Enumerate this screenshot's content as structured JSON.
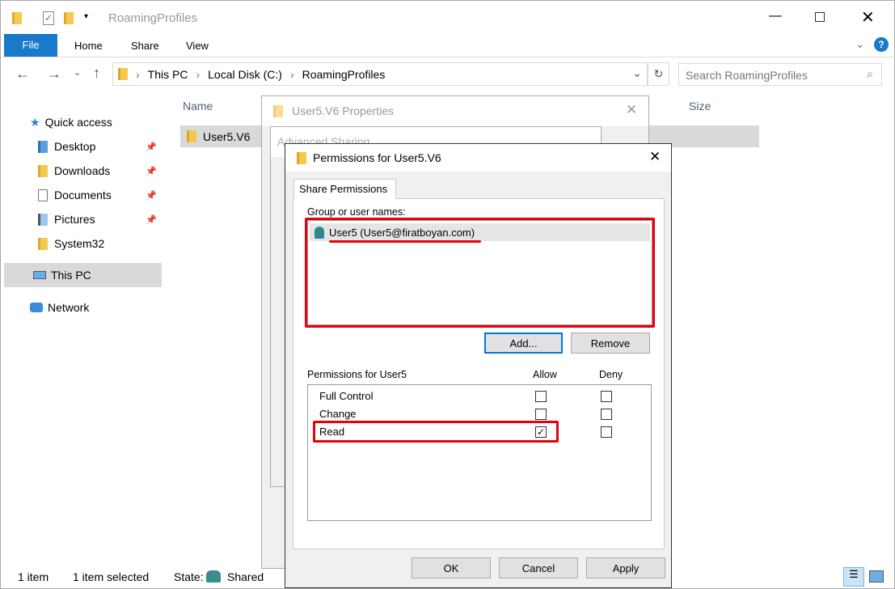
{
  "window": {
    "title": "RoamingProfiles"
  },
  "ribbon": {
    "tabs": [
      "File",
      "Home",
      "Share",
      "View"
    ]
  },
  "address": {
    "crumbs": [
      "This PC",
      "Local Disk (C:)",
      "RoamingProfiles"
    ],
    "search_placeholder": "Search RoamingProfiles"
  },
  "nav": {
    "quick_access": "Quick access",
    "items": [
      {
        "label": "Desktop",
        "pinned": true
      },
      {
        "label": "Downloads",
        "pinned": true
      },
      {
        "label": "Documents",
        "pinned": true
      },
      {
        "label": "Pictures",
        "pinned": true
      },
      {
        "label": "System32",
        "pinned": false
      }
    ],
    "this_pc": "This PC",
    "network": "Network"
  },
  "files": {
    "columns": [
      "Name",
      "Size"
    ],
    "rows": [
      {
        "name": "User5.V6"
      }
    ]
  },
  "properties_dialog": {
    "title": "User5.V6 Properties"
  },
  "advanced_dialog": {
    "title": "Advanced Sharing"
  },
  "perm_dialog": {
    "title": "Permissions for User5.V6",
    "tab": "Share Permissions",
    "group_label": "Group or user names:",
    "users": [
      "User5 (User5@firatboyan.com)"
    ],
    "add": "Add...",
    "remove": "Remove",
    "perm_label": "Permissions for User5",
    "allow": "Allow",
    "deny": "Deny",
    "permissions": [
      {
        "name": "Full Control",
        "allow": false,
        "deny": false
      },
      {
        "name": "Change",
        "allow": false,
        "deny": false
      },
      {
        "name": "Read",
        "allow": true,
        "deny": false
      }
    ],
    "ok": "OK",
    "cancel": "Cancel",
    "apply": "Apply"
  },
  "status": {
    "count": "1 item",
    "selected": "1 item selected",
    "state_label": "State:",
    "state_value": "Shared"
  },
  "colors": {
    "accent": "#1979ca",
    "highlight": "#e8000b"
  }
}
